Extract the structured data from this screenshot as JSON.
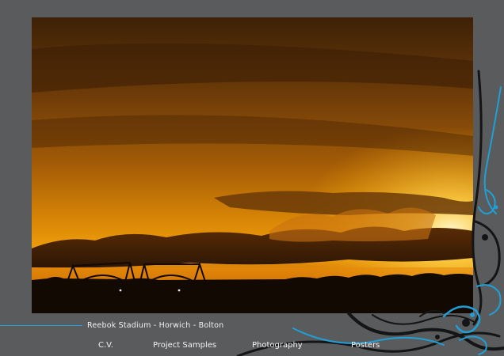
{
  "photo": {
    "alt": "Sunset over Reebok Stadium with orange clouds and stadium roof silhouette"
  },
  "caption": {
    "text": "Reebok Stadium - Horwich - Bolton"
  },
  "nav": {
    "items": [
      {
        "label": "C.V."
      },
      {
        "label": "Project Samples"
      },
      {
        "label": "Photography"
      },
      {
        "label": "Posters"
      }
    ]
  },
  "colors": {
    "background": "#5a5b5d",
    "accent": "#1f9fd6",
    "text": "#f2f2f2",
    "ornament_dark": "#151515"
  }
}
